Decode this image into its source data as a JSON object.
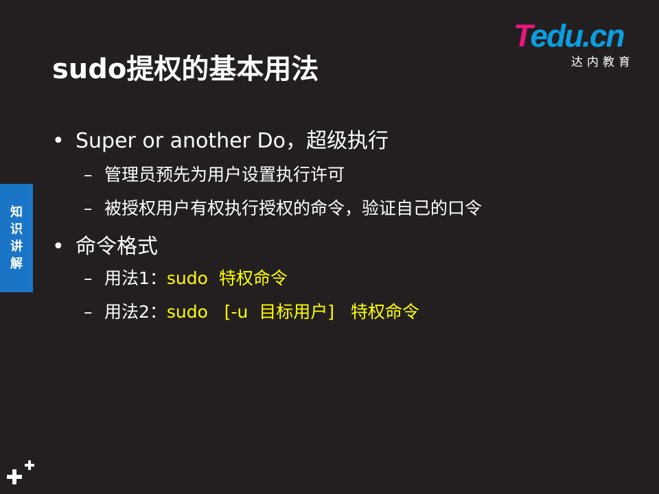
{
  "title": "sudo提权的基本用法",
  "logo": {
    "wordmark_first": "T",
    "wordmark_rest": "edu.cn",
    "subtitle": "达内教育"
  },
  "side_tab": {
    "chars": [
      "知",
      "识",
      "讲",
      "解"
    ]
  },
  "bullets": [
    {
      "bullet": "•",
      "text": "Super or another Do，超级执行"
    },
    {
      "dash": "–",
      "text": "管理员预先为用户设置执行许可"
    },
    {
      "dash": "–",
      "text": "被授权用户有权执行授权的命令，验证自己的口令"
    },
    {
      "bullet": "•",
      "text": "命令格式"
    },
    {
      "dash": "–",
      "label": "用法1：",
      "code": "sudo  特权命令"
    },
    {
      "dash": "–",
      "label": "用法2：",
      "code": "sudo   [-u  目标用户]   特权命令"
    }
  ],
  "colors": {
    "background": "#231f20",
    "text": "#ffffff",
    "highlight": "#ffff00",
    "tab": "#1b75c6",
    "logo_magenta": "#e8177e",
    "logo_blue": "#0a9ee0"
  }
}
